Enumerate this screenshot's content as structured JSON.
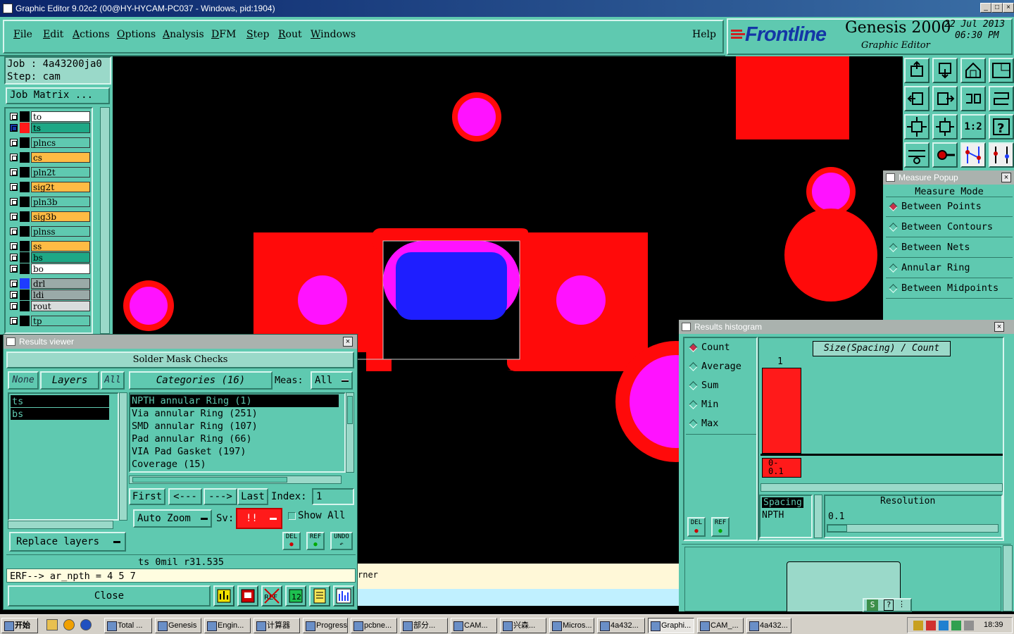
{
  "window": {
    "title": "Graphic Editor 9.02c2 (00@HY-HYCAM-PC037 - Windows, pid:1904)"
  },
  "menu": {
    "items": [
      {
        "label": "File",
        "u": "F"
      },
      {
        "label": "Edit",
        "u": "E"
      },
      {
        "label": "Actions",
        "u": "A"
      },
      {
        "label": "Options",
        "u": "O"
      },
      {
        "label": "Analysis",
        "u": "A"
      },
      {
        "label": "DFM",
        "u": "D"
      },
      {
        "label": "Step",
        "u": "S"
      },
      {
        "label": "Rout",
        "u": "R"
      },
      {
        "label": "Windows",
        "u": "W"
      }
    ],
    "help": "Help"
  },
  "brand": {
    "logo": "Frontline",
    "product": "Genesis 2000",
    "subtitle": "Graphic Editor",
    "date": "22 Jul 2013",
    "time": "06:30 PM"
  },
  "job": {
    "job_line": "Job : 4a43200ja0",
    "step_line": "Step: cam",
    "matrix_button": "Job Matrix ..."
  },
  "layers": [
    {
      "name": "to",
      "color": "#ffffff",
      "active": false
    },
    {
      "name": "ts",
      "color": "#1ea886",
      "active": true
    },
    {
      "name": "plncs",
      "color": "#5fc9b0",
      "active": false
    },
    {
      "name": "cs",
      "color": "#ffbb44",
      "active": false
    },
    {
      "name": "pln2t",
      "color": "#5fc9b0",
      "active": false
    },
    {
      "name": "sig2t",
      "color": "#ffbb44",
      "active": false
    },
    {
      "name": "pln3b",
      "color": "#5fc9b0",
      "active": false
    },
    {
      "name": "sig3b",
      "color": "#ffbb44",
      "active": false
    },
    {
      "name": "plnss",
      "color": "#5fc9b0",
      "active": false
    },
    {
      "name": "ss",
      "color": "#ffbb44",
      "active": false
    },
    {
      "name": "bs",
      "color": "#1ea886",
      "active": false
    },
    {
      "name": "bo",
      "color": "#ffffff",
      "active": false
    },
    {
      "name": "drl",
      "color": "#9aaaa8",
      "active": false
    },
    {
      "name": "ldi",
      "color": "#9aaaa8",
      "active": false
    },
    {
      "name": "rout",
      "color": "#d8dcdc",
      "active": false
    },
    {
      "name": "tp",
      "color": "#5fc9b0",
      "active": false
    }
  ],
  "results_viewer": {
    "title": "Results viewer",
    "header": "Solder Mask Checks",
    "none_btn": "None",
    "layers_btn": "Layers",
    "all_btn": "All",
    "categories_btn": "Categories (16)",
    "meas_label": "Meas:",
    "meas_value": "All",
    "layer_list": [
      "ts",
      "bs"
    ],
    "categories": [
      "NPTH annular Ring (1)",
      "Via annular Ring (251)",
      "SMD annular Ring (107)",
      "Pad annular Ring (66)",
      "VIA Pad Gasket (197)",
      "Coverage (15)"
    ],
    "first": "First",
    "prev": "<---",
    "next": "--->",
    "last": "Last",
    "index_label": "Index:",
    "index_value": "1",
    "auto_zoom": "Auto Zoom",
    "sv_label": "Sv:",
    "sv_value": "!!",
    "show_all": "Show All",
    "replace_layers": "Replace layers",
    "del": "DEL",
    "ref": "REF",
    "undo": "UNDO",
    "status": "ts 0mil   r31.535",
    "erf": "ERF--> ar_npth = 4 5 7",
    "close": "Close"
  },
  "canvas": {
    "hint_text": "rner"
  },
  "measure": {
    "title": "Measure Popup",
    "header": "Measure Mode",
    "options": [
      "Between Points",
      "Between Contours",
      "Between Nets",
      "Annular Ring",
      "Between Midpoints"
    ],
    "selected": 0
  },
  "histogram": {
    "title": "Results histogram",
    "modes": [
      "Count",
      "Average",
      "Sum",
      "Min",
      "Max"
    ],
    "selected": 0,
    "chart_title": "Size(Spacing) / Count",
    "bar_count": "1",
    "bar_label": "0-\n0.1",
    "spacing_label": "Spacing",
    "npth_label": "NPTH",
    "resolution_label": "Resolution",
    "resolution_value": "0.1",
    "del": "DEL",
    "ref": "REF"
  },
  "taskbar": {
    "start": "开始",
    "tasks": [
      "Total ...",
      "Genesis",
      "Engin...",
      "计算器",
      "Progress",
      "pcbne...",
      "部分...",
      "CAM...",
      "兴森...",
      "Micros...",
      "4a432...",
      "Graphi...",
      "CAM_...",
      "4a432..."
    ],
    "active": 11,
    "clock": "18:39"
  }
}
